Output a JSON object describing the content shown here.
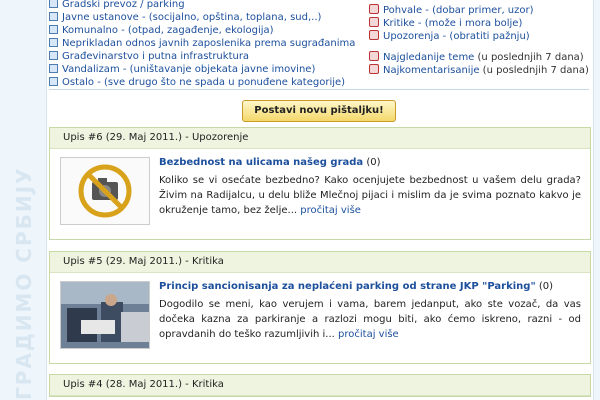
{
  "watermark": "ГРАДИМО СРБИЈУ",
  "categories": [
    {
      "label": "Gradski prevoz",
      "desc": " / parking"
    },
    {
      "label": "Javne ustanove",
      "desc": " - (socijalno, opština, toplana, sud,..)"
    },
    {
      "label": "Komunalno",
      "desc": " - (otpad, zagađenje, ekologija)"
    },
    {
      "label": "Neprikladan odnos javnih zaposlenika prema sugrađanima",
      "desc": ""
    },
    {
      "label": "Građevinarstvo i putna infrastruktura",
      "desc": ""
    },
    {
      "label": "Vandalizam",
      "desc": " - (uništavanje objekata javne imovine)"
    },
    {
      "label": "Ostalo",
      "desc": " - (sve drugo što ne spada u ponuđene kategorije)"
    }
  ],
  "side_links": [
    {
      "label": "Pohvale",
      "desc": " - (dobar primer, uzor)"
    },
    {
      "label": "Kritike",
      "desc": " - (može i mora bolje)"
    },
    {
      "label": "Upozorenja",
      "desc": " - (obratiti pažnju)"
    }
  ],
  "side_top": [
    {
      "label": "Najgledanije teme",
      "note": " (u poslednjih 7 dana)"
    },
    {
      "label": "Najkomentarisanije",
      "note": " (u poslednjih 7 dana)"
    }
  ],
  "post_button": "Postavi novu pištaljku!",
  "entries": [
    {
      "header": "Upis #6 (29. Maj 2011.) - Upozorenje",
      "title": "Bezbednost na ulicama našeg grada",
      "count": " (0)",
      "text": "Koliko se vi osećate bezbedno? Kako ocenjujete bezbednost u vašem delu grada? Živim na Radijalcu, u delu bliže Mlečnoj pijaci i mislim da je svima poznato kakvo je okruženje tamo, bez želje...",
      "more": "pročitaj više"
    },
    {
      "header": "Upis #5 (29. Maj 2011.) - Kritika",
      "title": "Princip sancionisanja za neplaćeni parking od strane JKP \"Parking\"",
      "count": " (0)",
      "text": "Dogodilo se meni, kao verujem i vama, barem jedanput, ako ste vozač, da vas dočeka kazna za parkiranje a razlozi mogu biti, ako ćemo iskreno, razni - od opravdanih do teško razumljivih i...",
      "more": "pročitaj više"
    },
    {
      "header": "Upis #4 (28. Maj 2011.) - Kritika"
    }
  ]
}
